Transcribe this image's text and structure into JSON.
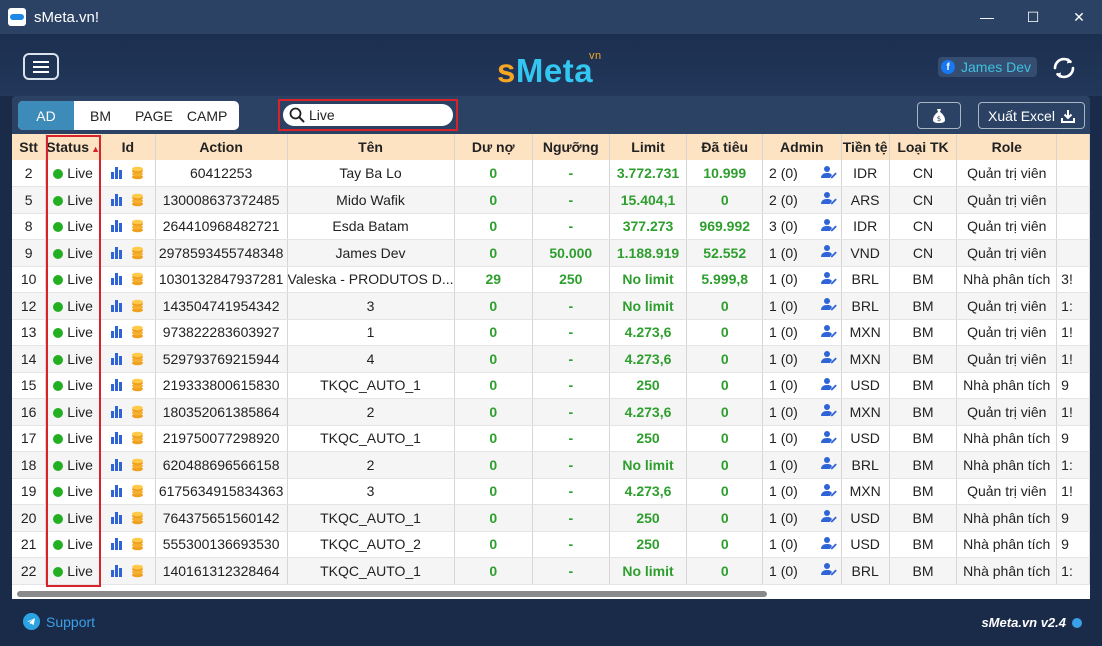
{
  "window": {
    "title": "sMeta.vn!",
    "minimize": "—",
    "maximize": "☐",
    "close": "✕"
  },
  "header": {
    "logo_s": "s",
    "logo_meta": "Meta",
    "logo_vn": "vn",
    "user": "James Dev"
  },
  "toolbar": {
    "tabs": [
      "AD",
      "BM",
      "PAGE",
      "CAMP"
    ],
    "active_tab": "AD",
    "search_value": "Live",
    "excel_label": "Xuất Excel"
  },
  "table": {
    "columns": [
      "Stt",
      "Status",
      "Id",
      "Action",
      "Tên",
      "Dư nợ",
      "Ngưỡng",
      "Limit",
      "Đã tiêu",
      "Admin",
      "Tiền tệ",
      "Loại TK",
      "Role"
    ],
    "rows": [
      {
        "stt": "2",
        "status": "Live",
        "action": "60412253",
        "ten": "Tay Ba Lo",
        "duno": "0",
        "nguong": "-",
        "limit": "3.772.731",
        "datieu": "10.999",
        "admin": "2 (0)",
        "tiente": "IDR",
        "loaitk": "CN",
        "role": "Quản trị viên",
        "extra": ""
      },
      {
        "stt": "5",
        "status": "Live",
        "action": "130008637372485",
        "ten": "Mido Wafik",
        "duno": "0",
        "nguong": "-",
        "limit": "15.404,1",
        "datieu": "0",
        "admin": "2 (0)",
        "tiente": "ARS",
        "loaitk": "CN",
        "role": "Quản trị viên",
        "extra": ""
      },
      {
        "stt": "8",
        "status": "Live",
        "action": "264410968482721",
        "ten": "Esda Batam",
        "duno": "0",
        "nguong": "-",
        "limit": "377.273",
        "datieu": "969.992",
        "admin": "3 (0)",
        "tiente": "IDR",
        "loaitk": "CN",
        "role": "Quản trị viên",
        "extra": ""
      },
      {
        "stt": "9",
        "status": "Live",
        "action": "2978593455748348",
        "ten": "James Dev",
        "duno": "0",
        "nguong": "50.000",
        "limit": "1.188.919",
        "datieu": "52.552",
        "admin": "1 (0)",
        "tiente": "VND",
        "loaitk": "CN",
        "role": "Quản trị viên",
        "extra": ""
      },
      {
        "stt": "10",
        "status": "Live",
        "action": "1030132847937281",
        "ten": "Valeska - PRODUTOS D...",
        "duno": "29",
        "nguong": "250",
        "limit": "No limit",
        "datieu": "5.999,8",
        "admin": "1 (0)",
        "tiente": "BRL",
        "loaitk": "BM",
        "role": "Nhà phân tích",
        "extra": "3!"
      },
      {
        "stt": "12",
        "status": "Live",
        "action": "143504741954342",
        "ten": "3",
        "duno": "0",
        "nguong": "-",
        "limit": "No limit",
        "datieu": "0",
        "admin": "1 (0)",
        "tiente": "BRL",
        "loaitk": "BM",
        "role": "Quản trị viên",
        "extra": "1:"
      },
      {
        "stt": "13",
        "status": "Live",
        "action": "973822283603927",
        "ten": "1",
        "duno": "0",
        "nguong": "-",
        "limit": "4.273,6",
        "datieu": "0",
        "admin": "1 (0)",
        "tiente": "MXN",
        "loaitk": "BM",
        "role": "Quản trị viên",
        "extra": "1!"
      },
      {
        "stt": "14",
        "status": "Live",
        "action": "529793769215944",
        "ten": "4",
        "duno": "0",
        "nguong": "-",
        "limit": "4.273,6",
        "datieu": "0",
        "admin": "1 (0)",
        "tiente": "MXN",
        "loaitk": "BM",
        "role": "Quản trị viên",
        "extra": "1!"
      },
      {
        "stt": "15",
        "status": "Live",
        "action": "219333800615830",
        "ten": "TKQC_AUTO_1",
        "duno": "0",
        "nguong": "-",
        "limit": "250",
        "datieu": "0",
        "admin": "1 (0)",
        "tiente": "USD",
        "loaitk": "BM",
        "role": "Nhà phân tích",
        "extra": "9"
      },
      {
        "stt": "16",
        "status": "Live",
        "action": "180352061385864",
        "ten": "2",
        "duno": "0",
        "nguong": "-",
        "limit": "4.273,6",
        "datieu": "0",
        "admin": "1 (0)",
        "tiente": "MXN",
        "loaitk": "BM",
        "role": "Quản trị viên",
        "extra": "1!"
      },
      {
        "stt": "17",
        "status": "Live",
        "action": "219750077298920",
        "ten": "TKQC_AUTO_1",
        "duno": "0",
        "nguong": "-",
        "limit": "250",
        "datieu": "0",
        "admin": "1 (0)",
        "tiente": "USD",
        "loaitk": "BM",
        "role": "Nhà phân tích",
        "extra": "9"
      },
      {
        "stt": "18",
        "status": "Live",
        "action": "620488696566158",
        "ten": "2",
        "duno": "0",
        "nguong": "-",
        "limit": "No limit",
        "datieu": "0",
        "admin": "1 (0)",
        "tiente": "BRL",
        "loaitk": "BM",
        "role": "Nhà phân tích",
        "extra": "1:"
      },
      {
        "stt": "19",
        "status": "Live",
        "action": "6175634915834363",
        "ten": "3",
        "duno": "0",
        "nguong": "-",
        "limit": "4.273,6",
        "datieu": "0",
        "admin": "1 (0)",
        "tiente": "MXN",
        "loaitk": "BM",
        "role": "Quản trị viên",
        "extra": "1!"
      },
      {
        "stt": "20",
        "status": "Live",
        "action": "764375651560142",
        "ten": "TKQC_AUTO_1",
        "duno": "0",
        "nguong": "-",
        "limit": "250",
        "datieu": "0",
        "admin": "1 (0)",
        "tiente": "USD",
        "loaitk": "BM",
        "role": "Nhà phân tích",
        "extra": "9"
      },
      {
        "stt": "21",
        "status": "Live",
        "action": "555300136693530",
        "ten": "TKQC_AUTO_2",
        "duno": "0",
        "nguong": "-",
        "limit": "250",
        "datieu": "0",
        "admin": "1 (0)",
        "tiente": "USD",
        "loaitk": "BM",
        "role": "Nhà phân tích",
        "extra": "9"
      },
      {
        "stt": "22",
        "status": "Live",
        "action": "140161312328464",
        "ten": "TKQC_AUTO_1",
        "duno": "0",
        "nguong": "-",
        "limit": "No limit",
        "datieu": "0",
        "admin": "1 (0)",
        "tiente": "BRL",
        "loaitk": "BM",
        "role": "Nhà phân tích",
        "extra": "1:"
      }
    ]
  },
  "footer": {
    "support": "Support",
    "version": "sMeta.vn v2.4"
  },
  "colors": {
    "accent": "#3c8bb8",
    "live": "#22b022",
    "value_green": "#2e9e2e",
    "highlight_red": "#d9232a",
    "header_bg": "#fde3c2"
  }
}
